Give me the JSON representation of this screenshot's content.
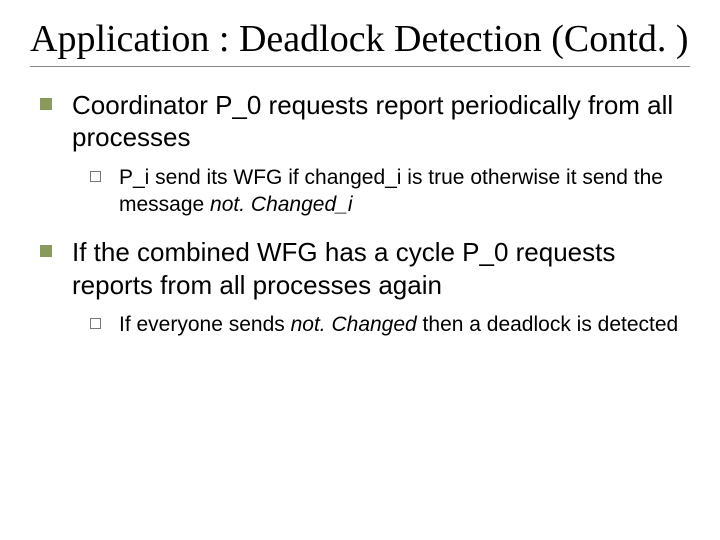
{
  "title": "Application : Deadlock Detection (Contd. )",
  "bullets": [
    {
      "text": "Coordinator P_0 requests report periodically from all processes",
      "sub": [
        {
          "pre": "P_i send its WFG if changed_i is true otherwise it send the message ",
          "em": "not. Changed_i"
        }
      ]
    },
    {
      "text": "If the combined WFG has a cycle P_0 requests reports from all processes again",
      "sub": [
        {
          "pre": "If everyone sends ",
          "em": "not. Changed",
          "post": "  then a deadlock is detected"
        }
      ]
    }
  ]
}
